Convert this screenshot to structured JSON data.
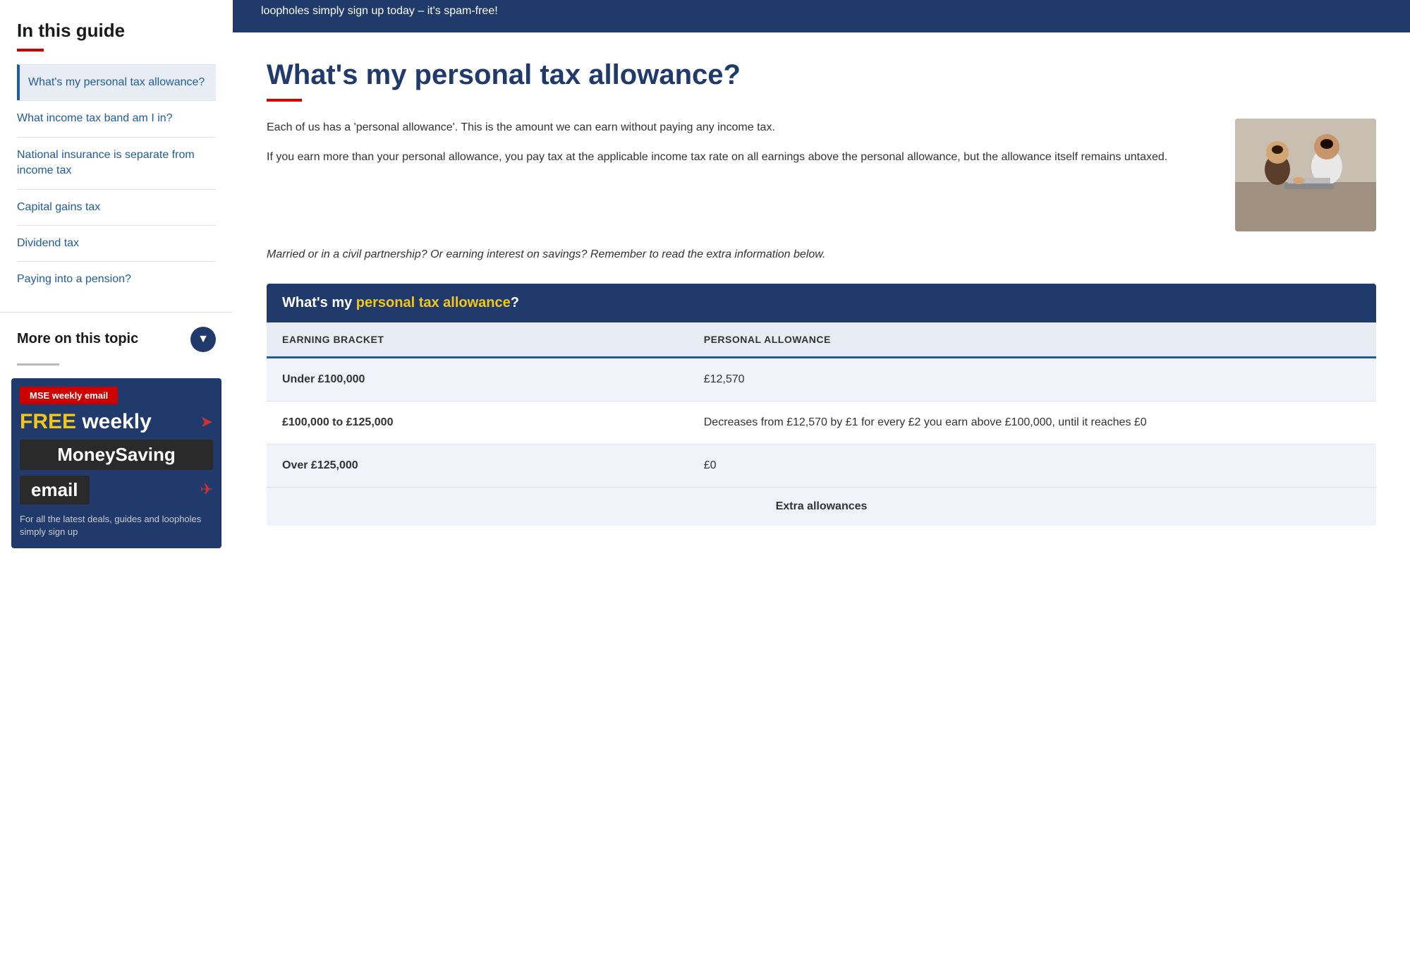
{
  "sidebar": {
    "guide_title": "In this guide",
    "nav_items": [
      {
        "id": "personal-tax-allowance",
        "label": "What's my personal tax allowance?",
        "active": true
      },
      {
        "id": "income-tax-band",
        "label": "What income tax band am I in?",
        "active": false
      },
      {
        "id": "national-insurance",
        "label": "National insurance is separate from income tax",
        "active": false
      },
      {
        "id": "capital-gains",
        "label": "Capital gains tax",
        "active": false
      },
      {
        "id": "dividend-tax",
        "label": "Dividend tax",
        "active": false
      },
      {
        "id": "pension",
        "label": "Paying into a pension?",
        "active": false
      }
    ],
    "more_on_topic": "More on this topic",
    "email_promo": {
      "badge": "MSE weekly email",
      "free": "FREE",
      "weekly": " weekly",
      "moneysaving": "MoneySaving",
      "email": "email",
      "footer": "For all the latest deals, guides and loopholes simply sign up"
    }
  },
  "top_banner": {
    "text": "loopholes simply sign up today – it's spam-free!"
  },
  "article": {
    "title": "What's my personal tax allowance?",
    "intro_para1": "Each of us has a 'personal allowance'. This is the amount we can earn without paying any income tax.",
    "intro_para2": "If you earn more than your personal allowance, you pay tax at the applicable income tax rate on all earnings above the personal allowance, but the allowance itself remains untaxed.",
    "intro_italic": "Married or in a civil partnership? Or earning interest on savings? Remember to read the extra information below.",
    "table": {
      "header_text_normal": "What's my ",
      "header_text_highlight": "personal tax allowance",
      "header_text_end": "?",
      "col1_header": "EARNING BRACKET",
      "col2_header": "PERSONAL ALLOWANCE",
      "rows": [
        {
          "bracket": "Under £100,000",
          "allowance": "£12,570"
        },
        {
          "bracket": "£100,000 to £125,000",
          "allowance": "Decreases from £12,570 by £1 for every £2 you earn above £100,000, until it reaches £0"
        },
        {
          "bracket": "Over £125,000",
          "allowance": "£0"
        }
      ],
      "footer_text": "Extra allowances"
    }
  }
}
